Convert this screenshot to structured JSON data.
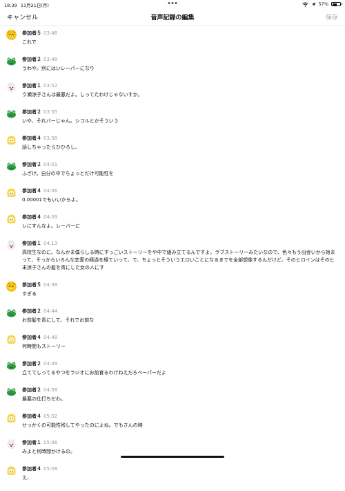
{
  "status": {
    "time": "18:39",
    "date": "11月21日(月)",
    "battery": "57%",
    "battery_level": 0.57
  },
  "nav": {
    "cancel": "キャンセル",
    "title": "音声記録の編集",
    "save": "保存"
  },
  "entries": [
    {
      "speaker": "参加者５",
      "time": "03:46",
      "text": "これで",
      "avatar": "bear-icon"
    },
    {
      "speaker": "参加者２",
      "time": "03:48",
      "text": "うわや。別にはいレーバーになり",
      "avatar": "frog-icon"
    },
    {
      "speaker": "参加者１",
      "time": "03:52",
      "text": "ウ瀬涼子さんは最悪だよ。しってたわけじゃないすか。",
      "avatar": "rabbit-icon"
    },
    {
      "speaker": "参加者２",
      "time": "03:55",
      "text": "いや、それバーじゃん。シコルとかそういう",
      "avatar": "frog-icon"
    },
    {
      "speaker": "参加者４",
      "time": "03:58",
      "text": "話しちゃったらひひろし、",
      "avatar": "girl-icon"
    },
    {
      "speaker": "参加者２",
      "time": "04:01",
      "text": "ふざけ。自分の中でちょっとだけ可能性を",
      "avatar": "frog-icon"
    },
    {
      "speaker": "参加者４",
      "time": "04:06",
      "text": "0.00001でもいいからよ。",
      "avatar": "girl-icon"
    },
    {
      "speaker": "参加者４",
      "time": "04:09",
      "text": "レにすんなよ。レーバーに",
      "avatar": "girl-icon"
    },
    {
      "speaker": "参加者１",
      "time": "04:13",
      "text": "高校生なのに、なんかま僕らしる時にすっごいストーリーをや中で組み立てるんですよ。ラブストーリーみたいなので、色々もう出会いから始まって、そっからいろんな恋愛の経過を経ていって、で、ちょっとそういうエロいことになるまでを全部想像するんだけど、そのヒロインはそのヒ末涼子さんの髪を青にした女の人にす",
      "avatar": "rabbit-icon"
    },
    {
      "speaker": "参加者５",
      "time": "04:38",
      "text": "すぎる",
      "avatar": "bear-icon"
    },
    {
      "speaker": "参加者２",
      "time": "04:44",
      "text": "お前髪を青にして、それでお前な",
      "avatar": "frog-icon"
    },
    {
      "speaker": "参加者４",
      "time": "04:48",
      "text": "何時間もストーリー",
      "avatar": "girl-icon"
    },
    {
      "speaker": "参加者２",
      "time": "04:49",
      "text": "立ててしってるやつをラジオにお前食るわけねえだろペーパーだよ",
      "avatar": "frog-icon"
    },
    {
      "speaker": "参加者２",
      "time": "04:58",
      "text": "最悪の仕打ちだわ。",
      "avatar": "frog-icon"
    },
    {
      "speaker": "参加者４",
      "time": "05:02",
      "text": "せっかくの可能性残してやったのによね。でもさんの時",
      "avatar": "girl-icon"
    },
    {
      "speaker": "参加者１",
      "time": "05:06",
      "text": "みよと何時間かけるの。",
      "avatar": "rabbit-icon"
    },
    {
      "speaker": "参加者４",
      "time": "05:08",
      "text": "え、",
      "avatar": "girl-icon"
    }
  ]
}
